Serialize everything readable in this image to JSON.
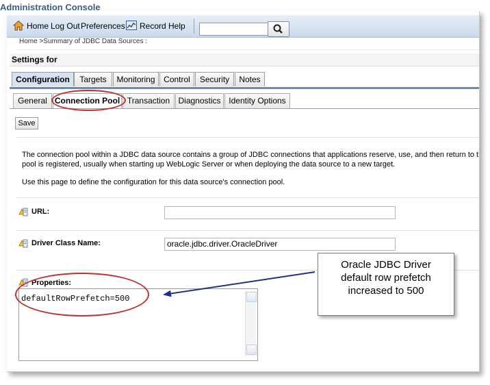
{
  "app": {
    "title": "Administration Console"
  },
  "toolbar": {
    "home": "Home",
    "logout": "Log Out",
    "preferences": "Preferences",
    "record": "Record",
    "help": "Help",
    "search_value": "",
    "icons": {
      "home": "home-icon",
      "record": "record-icon",
      "search": "search-icon"
    }
  },
  "breadcrumb": "Home >Summary of JDBC Data Sources :",
  "settings": {
    "title": "Settings for"
  },
  "tabs": [
    "Configuration",
    "Targets",
    "Monitoring",
    "Control",
    "Security",
    "Notes"
  ],
  "subtabs": [
    "General",
    "Connection Pool",
    "Transaction",
    "Diagnostics",
    "Identity Options"
  ],
  "actions": {
    "save": "Save"
  },
  "description": {
    "line1": "The connection pool within a JDBC data source contains a group of JDBC connections that applications reserve, use, and then return to th",
    "line2": "pool is registered, usually when starting up WebLogic Server or when deploying the data source to a new target.",
    "line3": "Use this page to define the configuration for this data source's connection pool."
  },
  "fields": {
    "url": {
      "label": "URL:",
      "value": ""
    },
    "driver": {
      "label": "Driver Class Name:",
      "value": "oracle.jdbc.driver.OracleDriver"
    },
    "properties": {
      "label": "Properties:",
      "value": "defaultRowPrefetch=500"
    }
  },
  "annotation": {
    "line1": "Oracle JDBC Driver",
    "line2": "default row prefetch",
    "line3": "increased to 500"
  },
  "colors": {
    "highlight": "#c0312d",
    "arrow": "#1f2f8a",
    "tab_active": "#d5e3f2",
    "title": "#3b5e83"
  }
}
